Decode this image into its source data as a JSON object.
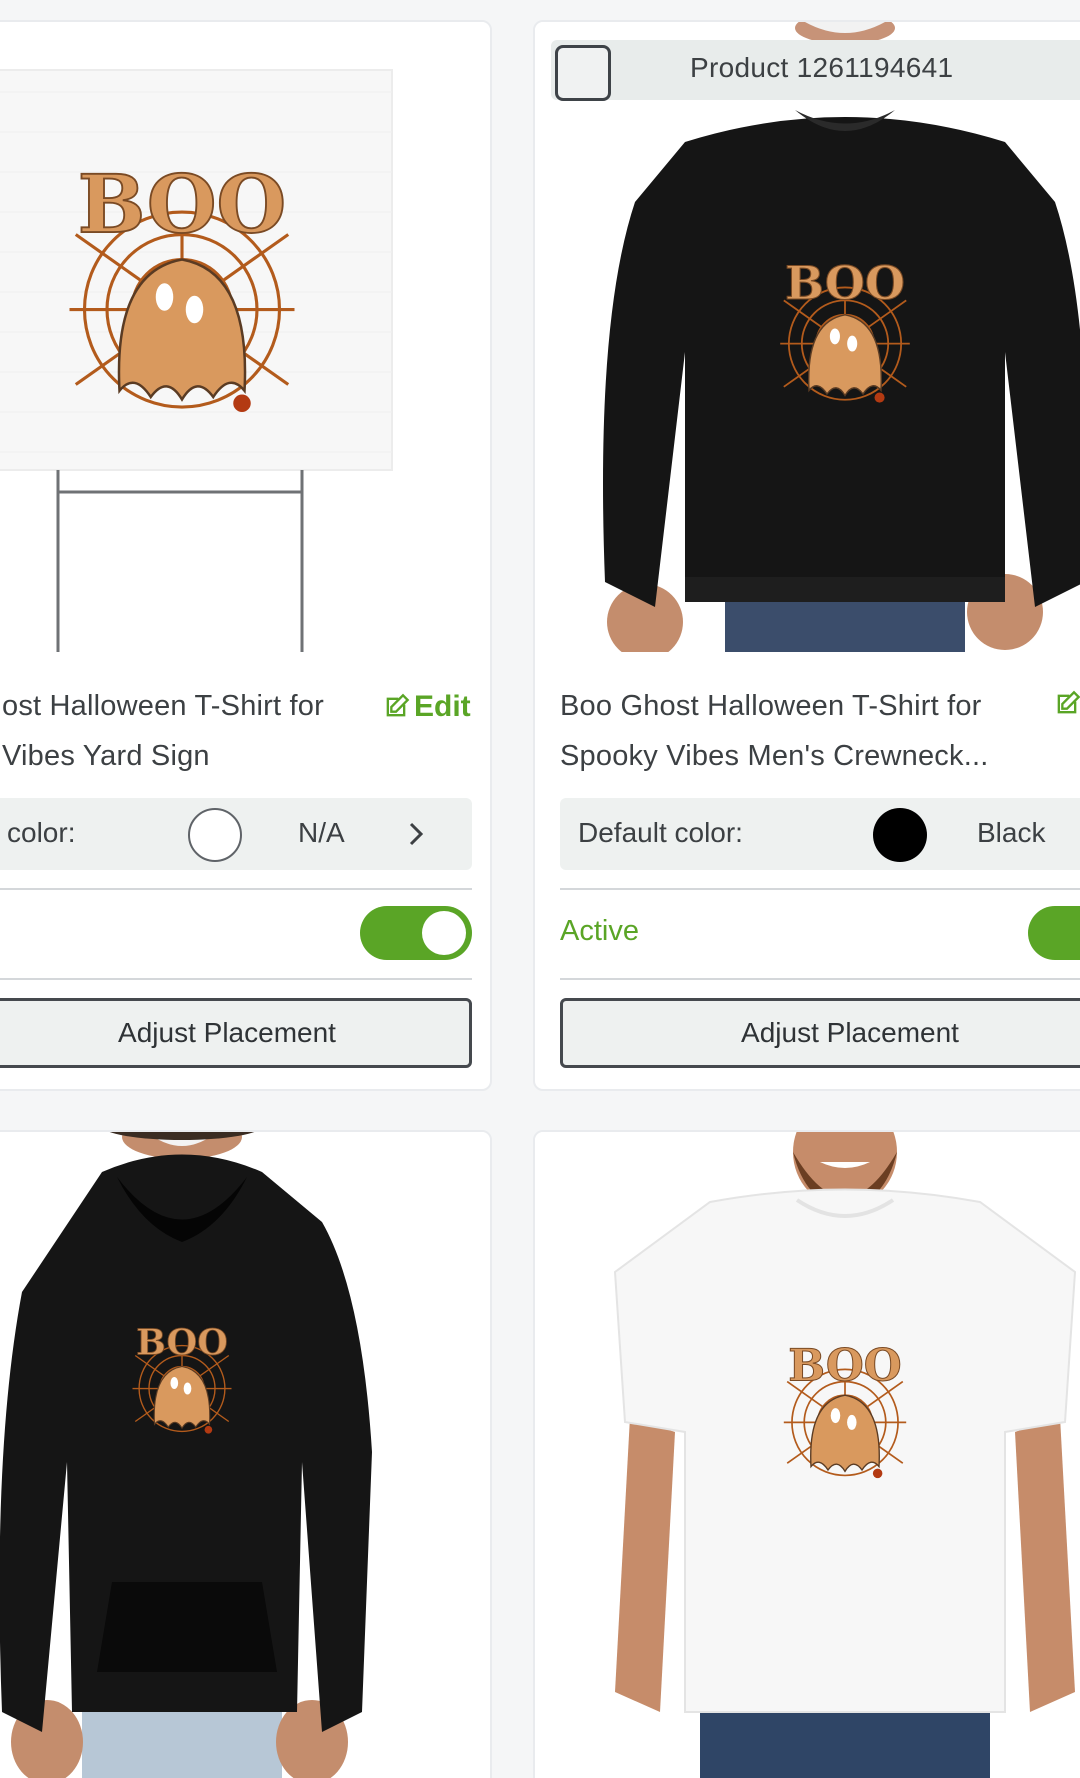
{
  "colors": {
    "accent": "#5aa526",
    "background": "#f5f6f7",
    "card": "#ffffff",
    "print": "#d9995e",
    "black_garment": "#151515",
    "white_garment": "#f7f7f7"
  },
  "products": [
    {
      "title_lines": [
        "ost Halloween T-Shirt for",
        "Vibes Yard Sign"
      ],
      "edit_label": "Edit",
      "default_color_label": "color:",
      "default_color_value": "N/A",
      "swatch": "none",
      "status": "",
      "active": true,
      "adjust_label": "Adjust Placement",
      "image": "yard-sign-boo-ghost"
    },
    {
      "product_id": "Product 1261194641",
      "title_lines": [
        "Boo Ghost Halloween T-Shirt for",
        "Spooky Vibes Men's Crewneck..."
      ],
      "default_color_label": "Default color:",
      "default_color_value": "Black",
      "swatch": "#000000",
      "status": "Active",
      "active": true,
      "adjust_label": "Adjust Placement",
      "image": "black-crewneck-boo-ghost"
    },
    {
      "image": "black-hoodie-boo-ghost"
    },
    {
      "image": "white-tshirt-boo-ghost"
    }
  ],
  "print_text": "BOO"
}
